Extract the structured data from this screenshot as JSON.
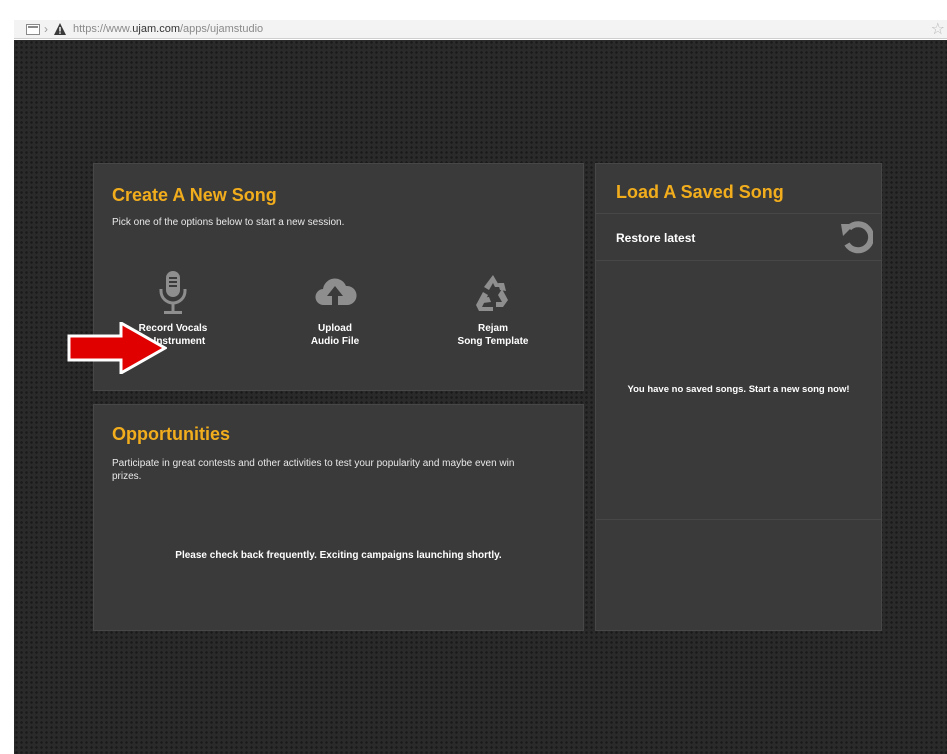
{
  "browser": {
    "url_prefix": "https://www.",
    "url_domain": "ujam.com",
    "url_path": "/apps/ujamstudio"
  },
  "create": {
    "title": "Create A New Song",
    "subtitle": "Pick one of the options below to start a new session.",
    "options": [
      {
        "line1": "Record Vocals",
        "line2": "or Instrument",
        "icon": "microphone-icon"
      },
      {
        "line1": "Upload",
        "line2": "Audio File",
        "icon": "cloud-upload-icon"
      },
      {
        "line1": "Rejam",
        "line2": "Song Template",
        "icon": "recycle-icon"
      }
    ]
  },
  "opportunities": {
    "title": "Opportunities",
    "description": "Participate in great contests and other activities to test your popularity and maybe even win prizes.",
    "note": "Please check back frequently. Exciting campaigns launching shortly."
  },
  "load": {
    "title": "Load A Saved Song",
    "restore_label": "Restore latest",
    "empty_message": "You have no saved songs. Start a new song now!"
  },
  "colors": {
    "accent": "#f2ad1d",
    "panel": "#3a3a3a",
    "background": "#2a2a2a",
    "arrow": "#e00000"
  }
}
